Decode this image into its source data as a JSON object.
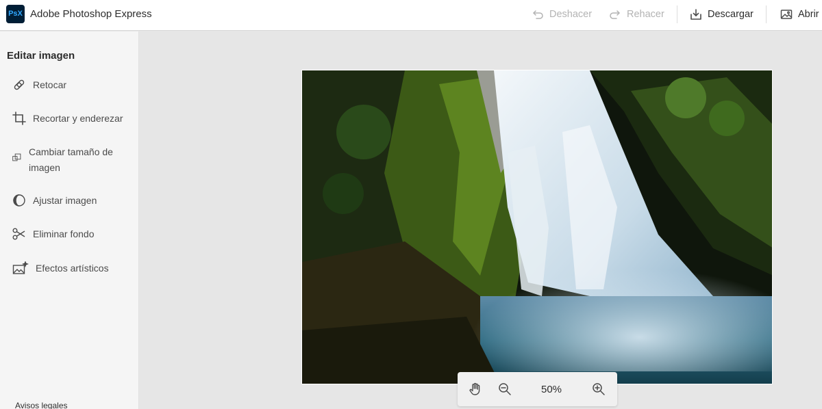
{
  "app": {
    "logo_text": "PsX",
    "title": "Adobe Photoshop Express"
  },
  "toolbar": {
    "undo_label": "Deshacer",
    "redo_label": "Rehacer",
    "download_label": "Descargar",
    "open_label": "Abrir"
  },
  "sidebar": {
    "title": "Editar imagen",
    "items": [
      {
        "label": "Retocar",
        "icon": "bandage-icon"
      },
      {
        "label": "Recortar y enderezar",
        "icon": "crop-icon"
      },
      {
        "label": "Cambiar tamaño de imagen",
        "icon": "resize-icon"
      },
      {
        "label": "Ajustar imagen",
        "icon": "adjust-icon"
      },
      {
        "label": "Eliminar fondo",
        "icon": "scissors-icon"
      },
      {
        "label": "Efectos artísticos",
        "icon": "sparkle-image-icon"
      }
    ],
    "legal_link": "Avisos legales"
  },
  "canvas": {
    "image_subject": "waterfall-photo"
  },
  "zoom": {
    "level": "50%"
  },
  "colors": {
    "logo_bg": "#001e36",
    "logo_text": "#31a8ff",
    "workspace_bg": "#e6e6e6",
    "sidebar_bg": "#f5f5f5",
    "disabled_text": "#b3b3b3"
  }
}
